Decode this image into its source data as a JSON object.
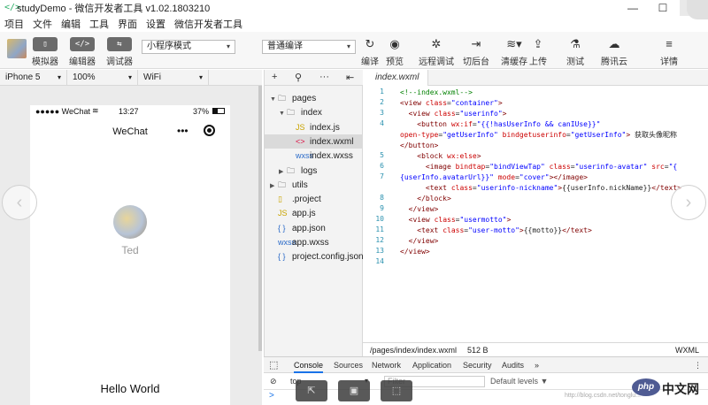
{
  "window": {
    "title": "studyDemo - 微信开发者工具 v1.02.1803210",
    "app_icon": "</>",
    "controls": [
      "—",
      "☐",
      "✕"
    ]
  },
  "menubar": [
    "项目",
    "文件",
    "编辑",
    "工具",
    "界面",
    "设置",
    "微信开发者工具"
  ],
  "toolbar": {
    "simulator": "模拟器",
    "editor": "编辑器",
    "debugger": "调试器",
    "mode_select": "小程序模式",
    "compile_select": "普通编译",
    "compile": "编译",
    "preview": "预览",
    "remote_debug": "远程调试",
    "switch_background": "切后台",
    "clear_cache": "清缓存",
    "upload": "上传",
    "test": "测试",
    "tencent_cloud": "腾讯云",
    "details": "详情"
  },
  "device_bar": {
    "device": "iPhone 5",
    "zoom": "100%",
    "network": "WiFi"
  },
  "phone": {
    "signal": "●●●●● WeChat",
    "wifi_icon": "wifi-icon",
    "time": "13:27",
    "battery": "37%",
    "nav_title": "WeChat",
    "menu_dots": "•••",
    "nickname": "Ted",
    "motto": "Hello World"
  },
  "tree": {
    "toolbar": [
      "+",
      "⚲",
      "···",
      "⇤"
    ],
    "items": [
      {
        "name": "pages",
        "type": "folder",
        "level": 0,
        "open": true
      },
      {
        "name": "index",
        "type": "folder",
        "level": 1,
        "open": true
      },
      {
        "name": "index.js",
        "type": "js",
        "level": 2
      },
      {
        "name": "index.wxml",
        "type": "wxml",
        "level": 2,
        "selected": true
      },
      {
        "name": "index.wxss",
        "type": "wxss",
        "level": 2
      },
      {
        "name": "logs",
        "type": "folder",
        "level": 1,
        "open": false
      },
      {
        "name": "utils",
        "type": "folder",
        "level": 0,
        "open": false
      },
      {
        "name": ".project",
        "type": "file",
        "level": 0
      },
      {
        "name": "app.js",
        "type": "js",
        "level": 0
      },
      {
        "name": "app.json",
        "type": "json",
        "level": 0
      },
      {
        "name": "app.wxss",
        "type": "wxss",
        "level": 0
      },
      {
        "name": "project.config.json",
        "type": "json",
        "level": 0
      }
    ],
    "icon_labels": {
      "js": "JS",
      "wxml": "<>",
      "wxss": "wxss",
      "json": "{ }",
      "file": "▯",
      "folder": "🗀"
    }
  },
  "editor": {
    "tab": "index.wxml",
    "line_numbers": [
      "1",
      "2",
      "3",
      "4",
      "",
      "",
      "5",
      "6",
      "7",
      "",
      "8",
      "9",
      "10",
      "11",
      "12",
      "13",
      "14"
    ],
    "path": "/pages/index/index.wxml",
    "size": "512 B",
    "language": "WXML"
  },
  "devtools": {
    "tabs": [
      "Console",
      "Sources",
      "Network",
      "Application",
      "Security",
      "Audits",
      "»"
    ],
    "context": "top",
    "filter_placeholder": "Filter",
    "levels": "Default levels ▼",
    "prompt": ">"
  },
  "watermark": {
    "url": "http://blog.csdn.net/tonglu...",
    "php": "php",
    "cn": "中文网"
  }
}
